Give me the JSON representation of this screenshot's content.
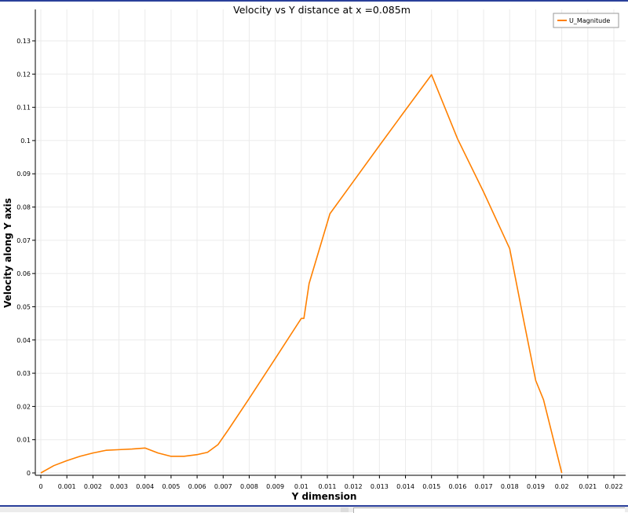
{
  "chart_data": {
    "type": "line",
    "title": "Velocity vs Y distance at x =0.085m",
    "xlabel": "Y dimension",
    "ylabel": "Velocity along Y axis",
    "xlim": [
      0,
      0.022
    ],
    "ylim": [
      0,
      0.13
    ],
    "xticks": [
      "0",
      "0.001",
      "0.002",
      "0.003",
      "0.004",
      "0.005",
      "0.006",
      "0.007",
      "0.008",
      "0.009",
      "0.01",
      "0.011",
      "0.012",
      "0.013",
      "0.014",
      "0.015",
      "0.016",
      "0.017",
      "0.018",
      "0.019",
      "0.02",
      "0.021",
      "0.022"
    ],
    "yticks": [
      "0",
      "0.01",
      "0.02",
      "0.03",
      "0.04",
      "0.05",
      "0.06",
      "0.07",
      "0.08",
      "0.09",
      "0.1",
      "0.11",
      "0.12",
      "0.13"
    ],
    "grid": true,
    "legend_position": "top-right",
    "series": [
      {
        "name": "U_Magnitude",
        "color": "#ff8000",
        "x": [
          0,
          0.0005,
          0.001,
          0.0015,
          0.002,
          0.0025,
          0.003,
          0.0035,
          0.004,
          0.0045,
          0.005,
          0.0055,
          0.006,
          0.0064,
          0.0068,
          0.0072,
          0.008,
          0.009,
          0.01,
          0.0101,
          0.0103,
          0.0111,
          0.012,
          0.013,
          0.014,
          0.015,
          0.016,
          0.017,
          0.018,
          0.0185,
          0.019,
          0.0193,
          0.02
        ],
        "y": [
          0,
          0.0022,
          0.0037,
          0.005,
          0.006,
          0.0068,
          0.007,
          0.0072,
          0.0075,
          0.006,
          0.005,
          0.005,
          0.0055,
          0.0062,
          0.0085,
          0.013,
          0.0224,
          0.0344,
          0.0465,
          0.0465,
          0.057,
          0.078,
          0.0877,
          0.0985,
          0.1092,
          0.1198,
          0.1005,
          0.0845,
          0.0675,
          0.0474,
          0.0278,
          0.022,
          0
        ]
      }
    ]
  }
}
